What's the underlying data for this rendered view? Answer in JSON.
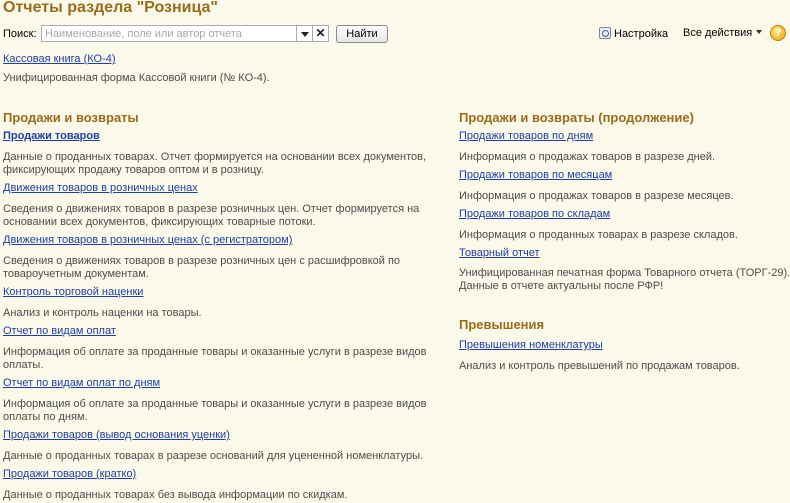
{
  "page_title": "Отчеты раздела \"Розница\"",
  "toolbar": {
    "search_label": "Поиск:",
    "search_placeholder": "Наименование, поле или автор отчета",
    "find_label": "Найти",
    "settings_label": "Настройка",
    "all_actions_label": "Все действия",
    "help_label": "?",
    "clear_glyph": "✕"
  },
  "top_report": {
    "link": "Кассовая книга (КО-4)",
    "description": "Унифицированная форма Кассовой книги (№ КО-4)."
  },
  "left_section": {
    "title": "Продажи и возвраты",
    "items": [
      {
        "link": "Продажи товаров",
        "desc": [
          "Данные о проданных товарах. Отчет формируется на основании всех документов,",
          "фиксирующих продажу товаров оптом и в розницу."
        ]
      },
      {
        "link": "Движения товаров в розничных ценах",
        "desc": [
          "Сведения о движениях товаров в разрезе розничных цен. Отчет формируется на",
          "основании всех документов, фиксирующих товарные потоки."
        ]
      },
      {
        "link": "Движения товаров в розничных ценах (с  регистратором)",
        "desc": [
          "Сведения о движениях товаров в разрезе розничных цен с расшифровкой по",
          "товароучетным документам."
        ]
      },
      {
        "link": "Контроль торговой наценки",
        "desc": [
          "Анализ и контроль наценки на товары."
        ]
      },
      {
        "link": "Отчет по видам оплат",
        "desc": [
          "Информация об оплате за проданные товары и оказанные услуги в разрезе видов",
          "оплаты."
        ]
      },
      {
        "link": "Отчет по видам оплат по дням",
        "desc": [
          "Информация об оплате за проданные товары и оказанные услуги в разрезе видов",
          "оплаты по дням."
        ]
      },
      {
        "link": "Продажи товаров (вывод основания уценки)",
        "desc": [
          "Данные о проданных товарах в разрезе оснований для уцененной номенклатуры."
        ]
      },
      {
        "link": "Продажи товаров (кратко)",
        "desc": [
          "Данные о проданных товарах без вывода информации по скидкам."
        ]
      }
    ]
  },
  "right_section": {
    "title": "Продажи и возвраты (продолжение)",
    "items": [
      {
        "link": "Продажи товаров по дням",
        "desc": [
          "Информация о продажах товаров в разрезе дней."
        ]
      },
      {
        "link": "Продажи товаров по месяцам",
        "desc": [
          "Информация о продажах товаров в разрезе месяцев."
        ]
      },
      {
        "link": "Продажи товаров по складам",
        "desc": [
          "Информация о проданных товарах в разрезе складов."
        ]
      },
      {
        "link": "Товарный отчет",
        "desc": [
          "Унифицированная печатная форма Товарного отчета (ТОРГ-29).",
          "Данные в отчете актуальны после РФР!"
        ]
      }
    ]
  },
  "exceed_section": {
    "title": "Превышения",
    "items": [
      {
        "link": "Превышения номенклатуры",
        "desc": [
          "Анализ и контроль превышений по продажам товаров."
        ]
      }
    ]
  },
  "colors": {
    "background": "#fbf9ea",
    "header": "#9a6b1a",
    "link": "#1d3fa6",
    "text": "#4d4d4d"
  }
}
